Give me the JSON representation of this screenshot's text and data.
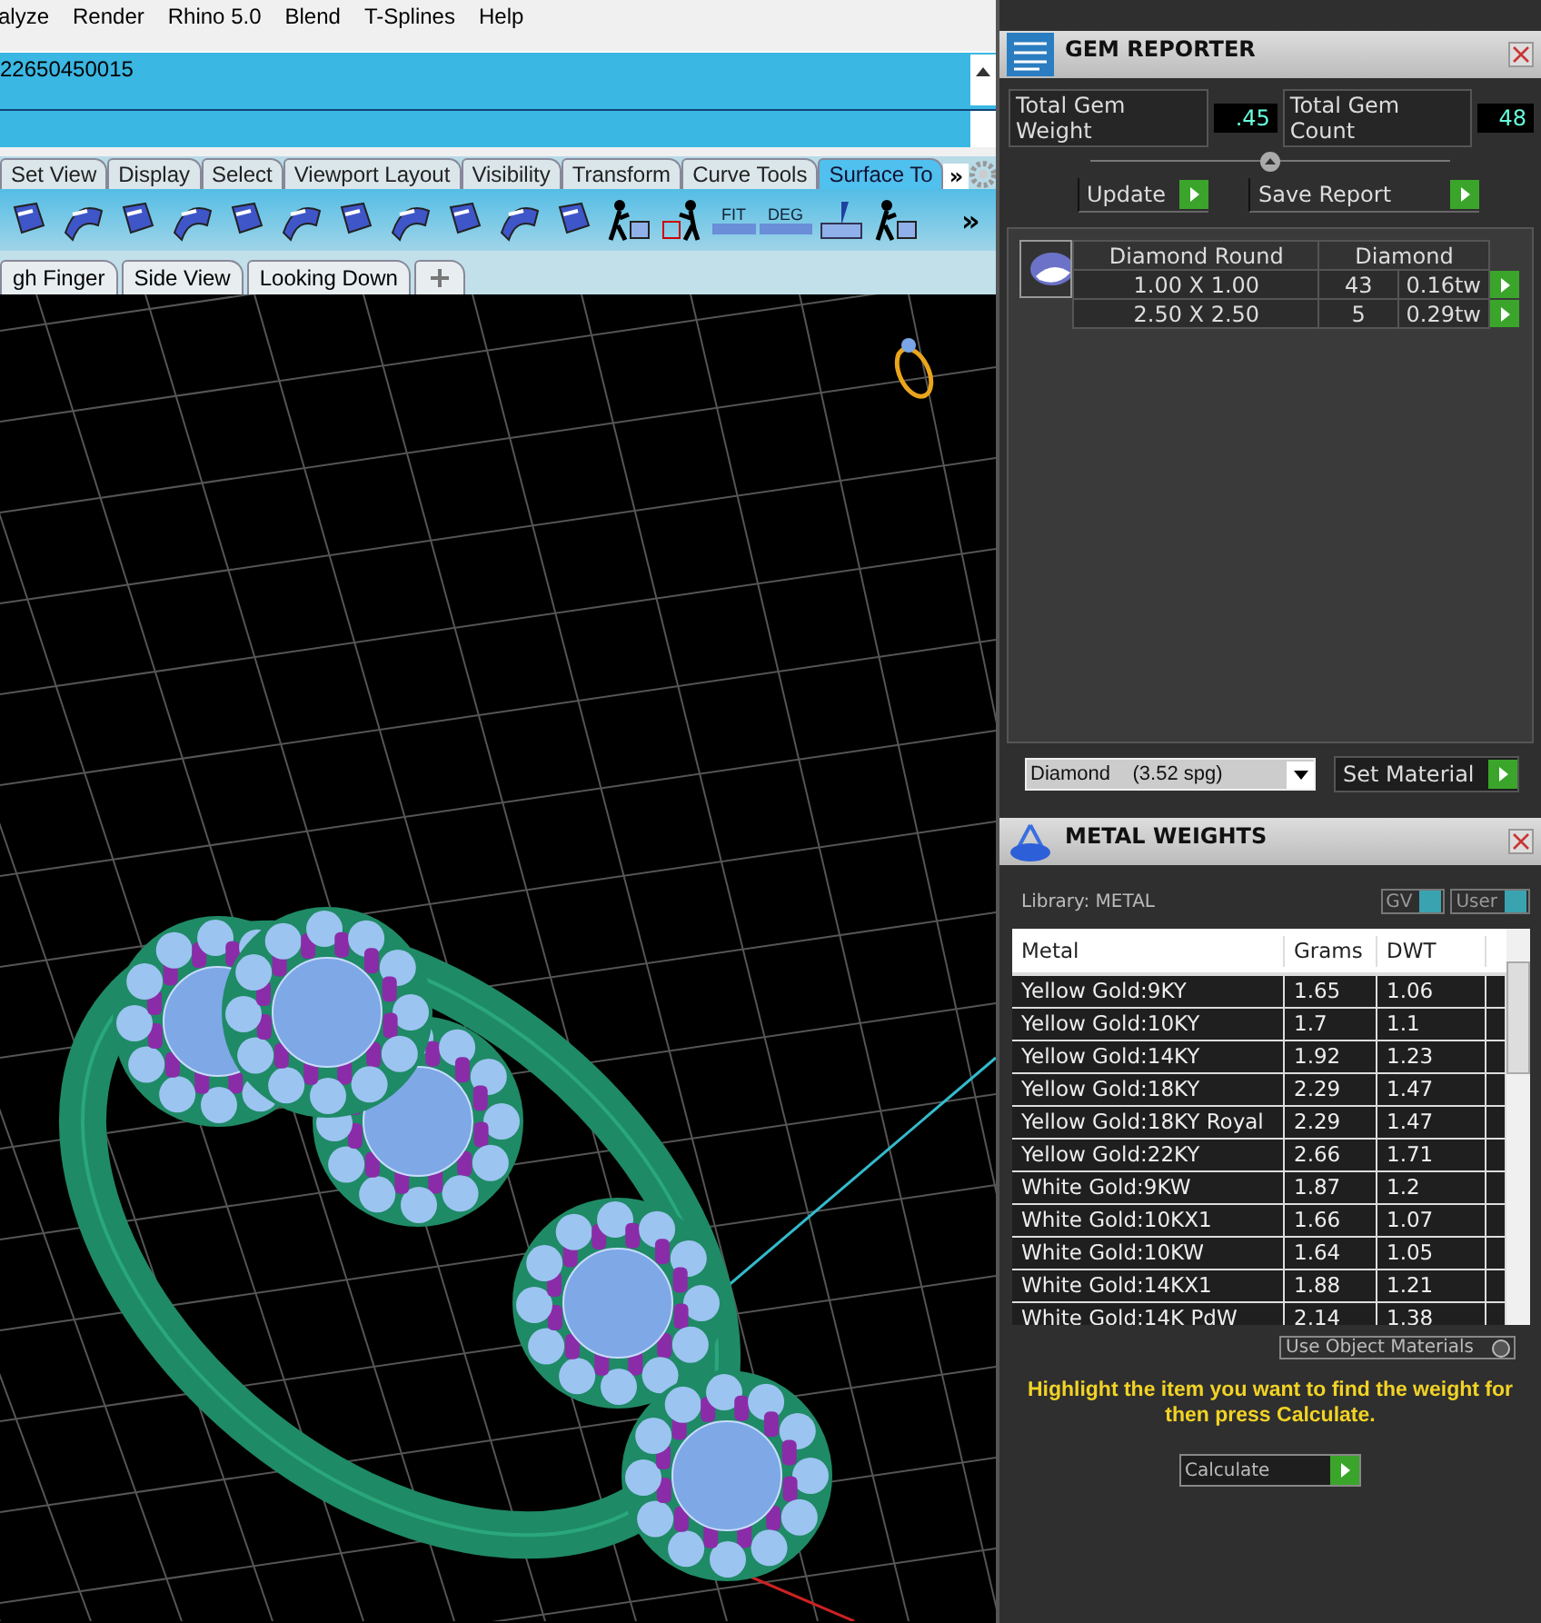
{
  "menu_bar": {
    "items": [
      "alyze",
      "Render",
      "Rhino 5.0",
      "Blend",
      "T-Splines",
      "Help"
    ]
  },
  "command_area": {
    "history_line": "22650450015"
  },
  "toolbar_tabs": [
    {
      "label": "Set View",
      "selected": false
    },
    {
      "label": "Display",
      "selected": false
    },
    {
      "label": "Select",
      "selected": false
    },
    {
      "label": "Viewport Layout",
      "selected": false
    },
    {
      "label": "Visibility",
      "selected": false
    },
    {
      "label": "Transform",
      "selected": false
    },
    {
      "label": "Curve Tools",
      "selected": false
    },
    {
      "label": "Surface To",
      "selected": true
    }
  ],
  "toolbar_tabs_overflow": "»",
  "toolbar": {
    "text_buttons": [
      "FIT",
      "DEG"
    ],
    "overflow": "»"
  },
  "viewport_tabs": [
    {
      "label": "gh Finger",
      "selected": false
    },
    {
      "label": "Side View",
      "selected": false
    },
    {
      "label": "Looking Down",
      "selected": false
    }
  ],
  "gem_reporter": {
    "title": "GEM REPORTER",
    "total_weight_label": "Total Gem Weight",
    "total_weight": ".45",
    "total_count_label": "Total Gem Count",
    "total_count": "48",
    "update_button": "Update",
    "save_button": "Save Report",
    "table": {
      "columns": [
        "Diamond Round",
        "Diamond"
      ],
      "rows": [
        {
          "size": "1.00 X 1.00",
          "count": "43",
          "weight": "0.16tw"
        },
        {
          "size": "2.50 X 2.50",
          "count": "5",
          "weight": "0.29tw"
        }
      ]
    },
    "material_select": "Diamond    (3.52 spg)",
    "set_material_button": "Set Material"
  },
  "metal_weights": {
    "title": "METAL WEIGHTS",
    "library_label": "Library: METAL",
    "toggles": [
      "GV",
      "User"
    ],
    "table": {
      "columns": [
        "Metal",
        "Grams",
        "DWT"
      ],
      "rows": [
        [
          "Yellow Gold:9KY",
          "1.65",
          "1.06"
        ],
        [
          "Yellow Gold:10KY",
          "1.7",
          "1.1"
        ],
        [
          "Yellow Gold:14KY",
          "1.92",
          "1.23"
        ],
        [
          "Yellow Gold:18KY",
          "2.29",
          "1.47"
        ],
        [
          "Yellow Gold:18KY Royal",
          "2.29",
          "1.47"
        ],
        [
          "Yellow Gold:22KY",
          "2.66",
          "1.71"
        ],
        [
          "White Gold:9KW",
          "1.87",
          "1.2"
        ],
        [
          "White Gold:10KX1",
          "1.66",
          "1.07"
        ],
        [
          "White Gold:10KW",
          "1.64",
          "1.05"
        ],
        [
          "White Gold:14KX1",
          "1.88",
          "1.21"
        ],
        [
          "White Gold:14K PdW",
          "2.14",
          "1.38"
        ]
      ]
    },
    "use_object_materials_button": "Use Object Materials",
    "instruction": "Highlight the item you want to find the weight for then press Calculate.",
    "calculate_button": "Calculate"
  }
}
